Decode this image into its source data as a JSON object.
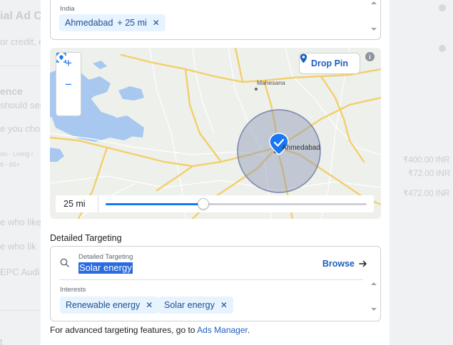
{
  "background": {
    "title_fragment": "ial Ad C",
    "subtitle_fragment": "or credit, c",
    "section_fragment": "ence",
    "section_sub_fragment": "should see",
    "audience_fragment": "e you cho",
    "detail_fragment_1": "on · Living i",
    "detail_fragment_2": "8 - 65+",
    "price_1": "₹400.00 INR",
    "price_2": "₹72.00 INR",
    "price_3": "₹472.00 INR",
    "row_1": "e who like",
    "row_2": "e who lik",
    "row_3": "EPC Audi",
    "row_4": "t"
  },
  "location": {
    "country": "India",
    "chip": {
      "city": "Ahmedabad",
      "radius": "+ 25 mi",
      "remove_icon": "close-icon"
    }
  },
  "map": {
    "zoom_in_label": "+",
    "zoom_out_label": "−",
    "drop_pin_label": "Drop Pin",
    "info_label": "i",
    "labels": {
      "mahesana": "Mahesana",
      "ahmedabad": "Ahmedabad"
    },
    "radius_value": "25 mi",
    "slider_fraction": 0.375,
    "colors": {
      "water": "#a8c8f0",
      "road_major": "#f3cf6a",
      "radius_fill": "#8a94b5",
      "pin": "#1877f2"
    }
  },
  "detailed_targeting": {
    "heading": "Detailed Targeting",
    "search_label": "Detailed Targeting",
    "search_value": "Solar energy",
    "browse_label": "Browse",
    "interests_label": "Interests",
    "interests": [
      {
        "label": "Renewable energy"
      },
      {
        "label": "Solar energy"
      }
    ]
  },
  "footer": {
    "text": "For advanced targeting features, go to",
    "link": "Ads Manager",
    "suffix": "."
  }
}
